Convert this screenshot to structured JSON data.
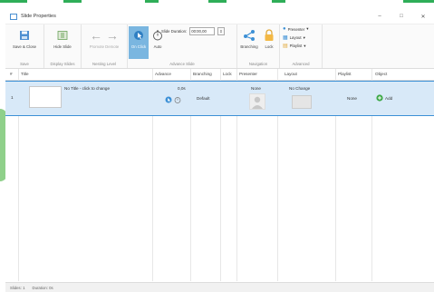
{
  "window": {
    "title": "Slide Properties",
    "controls": {
      "minimize": "–",
      "maximize": "□",
      "close": "✕"
    }
  },
  "ribbon": {
    "groups": {
      "save": {
        "label": "Save",
        "buttons": {
          "save_close": "Save & Close"
        }
      },
      "display": {
        "label": "Display Slides",
        "buttons": {
          "hide_slide": "Hide Slide"
        }
      },
      "nesting": {
        "label": "Nesting Level",
        "buttons": {
          "promote_demote": "Promote Demote"
        }
      },
      "advance": {
        "label": "Advance Slide",
        "buttons": {
          "on_click": "On Click",
          "auto": "Auto"
        },
        "duration_label": "Slide Duration:",
        "duration_value": "00:00,00"
      },
      "navigation": {
        "label": "Navigation",
        "buttons": {
          "branching": "Branching",
          "lock": "Lock"
        }
      },
      "advanced": {
        "label": "Advanced",
        "items": {
          "presenter": "Presenter",
          "layout": "Layout",
          "playlist": "Playlist"
        }
      }
    }
  },
  "grid": {
    "columns": {
      "num": "#",
      "title": "Title",
      "advance": "Advance",
      "branching": "Branching",
      "lock": "Lock",
      "presenter": "Presenter",
      "layout": "Layout",
      "playlist": "Playlist",
      "object": "Object"
    },
    "rows": [
      {
        "num": "1",
        "title": "No Title - click to change",
        "advance": "0,0s",
        "branching": "Default",
        "presenter": "None",
        "layout": "No Change",
        "playlist": "None",
        "object": "Add"
      }
    ]
  },
  "status": {
    "slides": "Slides: 1",
    "duration": "Duration: 0s"
  },
  "colors": {
    "accent": "#3c90d6",
    "selected_row": "#d8e9f8",
    "active_button": "#7ab6e0",
    "add_green": "#3fa94a"
  }
}
